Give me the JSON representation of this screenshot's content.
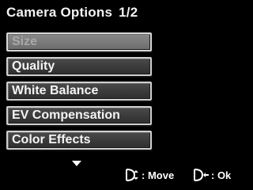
{
  "header": {
    "title": "Camera Options",
    "page": "1/2"
  },
  "menu": {
    "items": [
      {
        "label": "Size",
        "state": "disabled"
      },
      {
        "label": "Quality",
        "state": "normal"
      },
      {
        "label": "White Balance",
        "state": "normal"
      },
      {
        "label": "EV Compensation",
        "state": "normal"
      },
      {
        "label": "Color Effects",
        "state": "normal"
      }
    ],
    "more_indicator": "down-arrow-icon"
  },
  "footer": {
    "move_label": ": Move",
    "ok_label": ": Ok",
    "move_icon": "dpad-updown-icon",
    "ok_icon": "dpad-select-icon"
  }
}
